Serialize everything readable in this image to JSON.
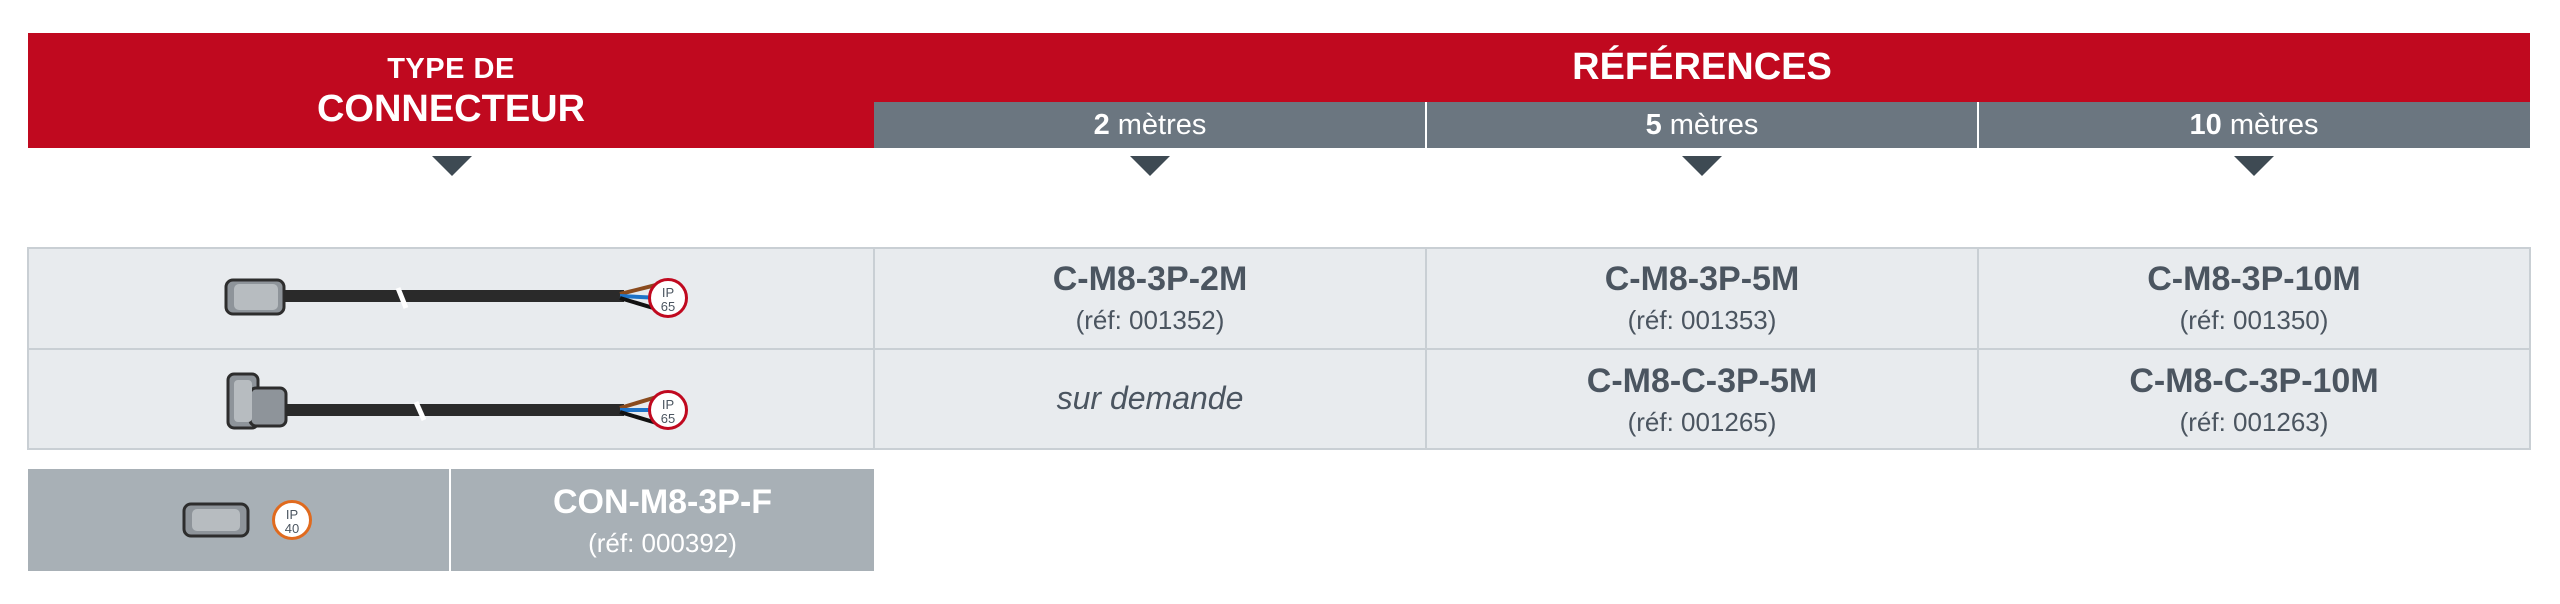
{
  "header": {
    "type_line1": "TYPE DE",
    "type_line2": "CONNECTEUR",
    "references": "RÉFÉRENCES",
    "lengths": [
      {
        "num": "2",
        "unit": " mètres"
      },
      {
        "num": "5",
        "unit": " mètres"
      },
      {
        "num": "10",
        "unit": " mètres"
      }
    ]
  },
  "rows": [
    {
      "connector_icon": "straight-connector-cable-icon",
      "ip_rating": {
        "top": "IP",
        "bottom": "65"
      },
      "cells": [
        {
          "code": "C-M8-3P-2M",
          "ref": "(réf: 001352)"
        },
        {
          "code": "C-M8-3P-5M",
          "ref": "(réf: 001353)"
        },
        {
          "code": "C-M8-3P-10M",
          "ref": "(réf: 001350)"
        }
      ]
    },
    {
      "connector_icon": "angled-connector-cable-icon",
      "ip_rating": {
        "top": "IP",
        "bottom": "65"
      },
      "cells": [
        {
          "note": "sur demande"
        },
        {
          "code": "C-M8-C-3P-5M",
          "ref": "(réf: 001265)"
        },
        {
          "code": "C-M8-C-3P-10M",
          "ref": "(réf: 001263)"
        }
      ]
    }
  ],
  "accessory": {
    "connector_icon": "female-connector-icon",
    "ip_rating": {
      "top": "IP",
      "bottom": "40"
    },
    "code": "CON-M8-3P-F",
    "ref": "(réf: 000392)"
  },
  "colors": {
    "brand_red": "#c0091f",
    "header_gray": "#6b7680",
    "row_bg": "#e8ebee",
    "accessory_bg": "#a8b0b6",
    "ip40_orange": "#e06a1e"
  }
}
